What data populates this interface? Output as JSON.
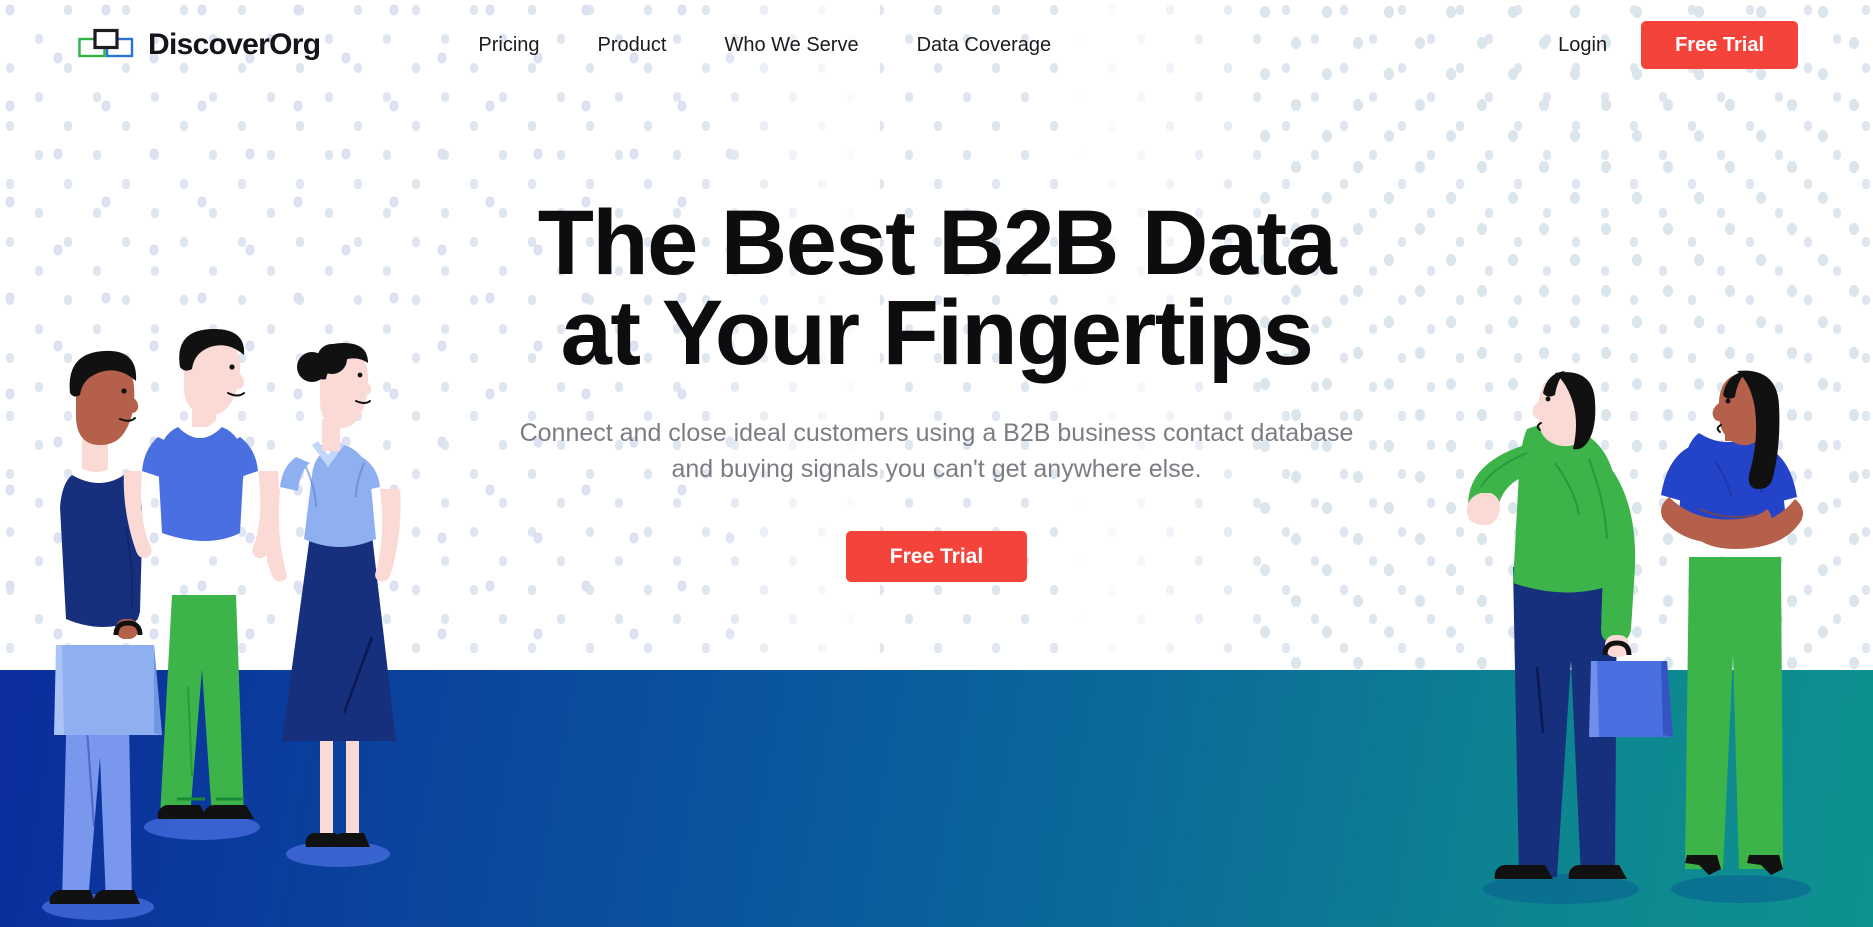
{
  "brand": {
    "name": "DiscoverOrg",
    "mark_icon": "overlapping-rectangles-logo-icon",
    "mark_colors": {
      "green": "#2fb34a",
      "blue": "#2a72d4",
      "dark": "#1d1d1f"
    }
  },
  "nav": {
    "items": [
      {
        "label": "Pricing",
        "name": "nav-pricing"
      },
      {
        "label": "Product",
        "name": "nav-product"
      },
      {
        "label": "Who We Serve",
        "name": "nav-who-we-serve"
      },
      {
        "label": "Data Coverage",
        "name": "nav-data-coverage"
      }
    ],
    "login_label": "Login",
    "trial_label": "Free Trial"
  },
  "hero": {
    "headline_line1": "The Best B2B Data",
    "headline_line2": "at Your Fingertips",
    "subheadline": "Connect and close ideal customers using a B2B business contact database and buying signals you can't get anywhere else.",
    "cta_label": "Free Trial"
  },
  "colors": {
    "accent_red": "#f4433a",
    "text_dark": "#0d0d0f",
    "text_muted": "#7c7c84",
    "ground_left": "#0b2d9c",
    "ground_right": "#0e9190",
    "dot_left": "#dde1f2",
    "dot_right": "#dae6ec",
    "illus_green": "#3cb44a",
    "illus_blue": "#4a6fe0",
    "illus_navy": "#17307e",
    "illus_lightblue": "#8fb0f0",
    "skin_light": "#fbd9d4",
    "skin_dark": "#b5604a"
  },
  "illustration": {
    "left_figures": [
      {
        "name": "figure-man-navy-sweater-briefcase",
        "top": "navy sweater",
        "bottom": "blue trousers",
        "accessory": "light blue briefcase"
      },
      {
        "name": "figure-man-blue-polo-green-pants",
        "top": "blue polo shirt",
        "bottom": "green trousers",
        "accessory": "none"
      },
      {
        "name": "figure-woman-lightblue-top-navy-skirt",
        "top": "light blue top",
        "bottom": "navy skirt",
        "accessory": "none"
      }
    ],
    "right_figures": [
      {
        "name": "figure-man-green-sweater-navy-pants-briefcase",
        "top": "green sweater",
        "bottom": "navy trousers",
        "accessory": "blue briefcase"
      },
      {
        "name": "figure-woman-blue-top-green-pants",
        "top": "blue top",
        "bottom": "green trousers",
        "accessory": "arms crossed"
      }
    ]
  }
}
